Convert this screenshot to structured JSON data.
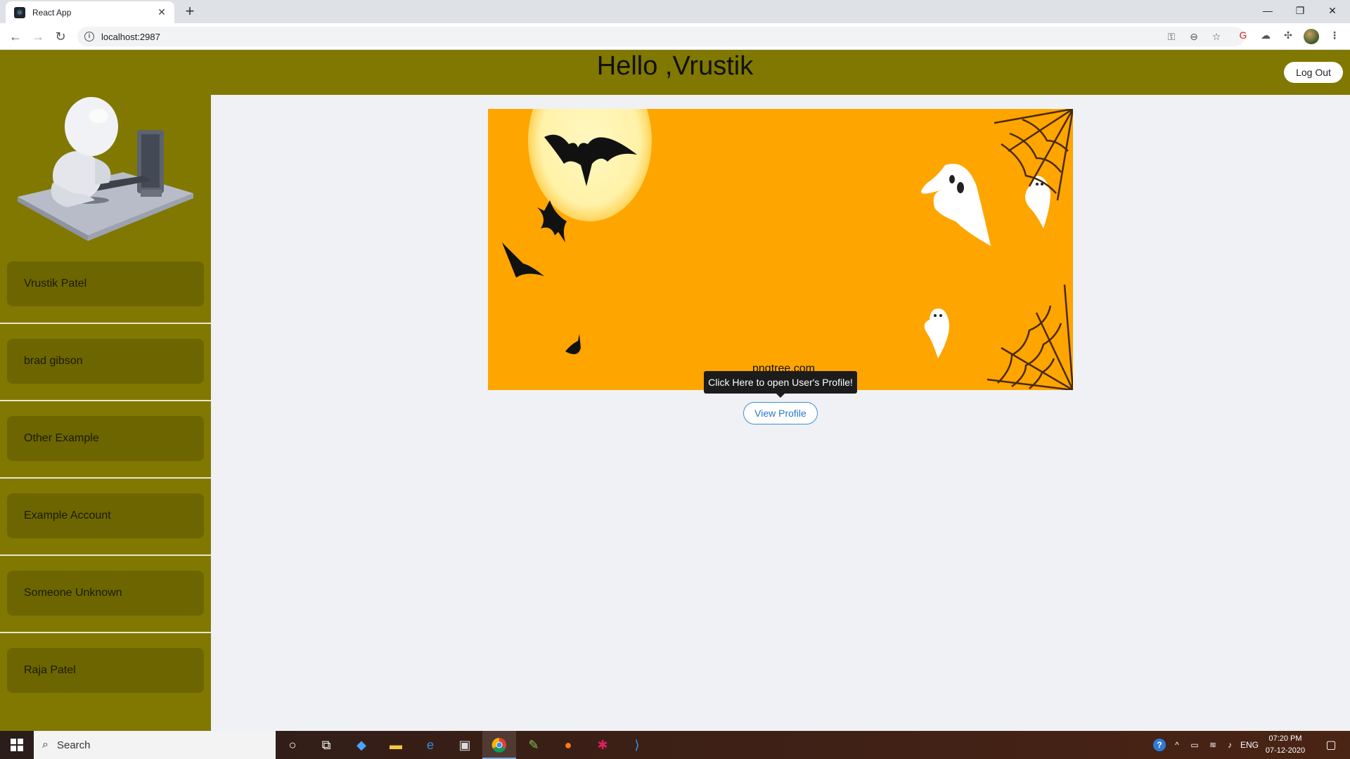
{
  "browser": {
    "tab_title": "React App",
    "tab_close": "✕",
    "new_tab": "+",
    "url": "localhost:2987",
    "window_controls": {
      "minimize": "—",
      "maximize": "❐",
      "close": "✕"
    }
  },
  "header": {
    "greeting": "Hello ,Vrustik",
    "logout_label": "Log Out"
  },
  "sidebar": {
    "users": [
      {
        "label": "Vrustik Patel"
      },
      {
        "label": "brad gibson"
      },
      {
        "label": "Other Example"
      },
      {
        "label": "Example Account"
      },
      {
        "label": "Someone Unknown"
      },
      {
        "label": "Raja Patel"
      }
    ]
  },
  "main": {
    "banner_watermark": "pngtree.com",
    "tooltip": "Click Here to open User's Profile!",
    "view_profile_label": "View Profile"
  },
  "taskbar": {
    "search_label": "Search",
    "language": "ENG",
    "time": "07:20 PM",
    "date": "07-12-2020"
  },
  "colors": {
    "header_bg": "#807800",
    "user_item_bg": "#6d6600",
    "banner_bg": "#ffa500",
    "page_bg": "#f0f1f5",
    "accent_blue": "#3a8fd8"
  }
}
